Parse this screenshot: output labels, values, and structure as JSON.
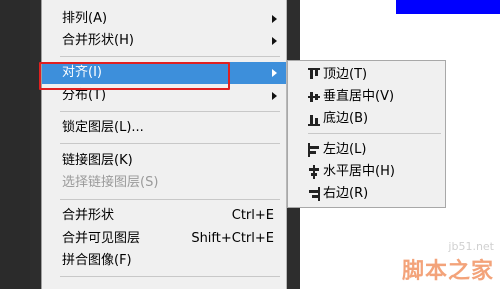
{
  "menu": {
    "items": [
      {
        "label": "排列(A)",
        "has_submenu": true
      },
      {
        "label": "合并形状(H)",
        "has_submenu": true
      },
      {
        "label": "对齐(I)",
        "has_submenu": true,
        "highlighted": true
      },
      {
        "label": "分布(T)",
        "has_submenu": true
      },
      {
        "label": "锁定图层(L)..."
      },
      {
        "label": "链接图层(K)"
      },
      {
        "label": "选择链接图层(S)",
        "disabled": true
      },
      {
        "label": "合并形状",
        "shortcut": "Ctrl+E"
      },
      {
        "label": "合并可见图层",
        "shortcut": "Shift+Ctrl+E"
      },
      {
        "label": "拼合图像(F)"
      }
    ]
  },
  "align_submenu": {
    "items": [
      {
        "label": "顶边(T)",
        "icon": "align-top-icon"
      },
      {
        "label": "垂直居中(V)",
        "icon": "align-vertical-center-icon"
      },
      {
        "label": "底边(B)",
        "icon": "align-bottom-icon"
      },
      {
        "label": "左边(L)",
        "icon": "align-left-icon"
      },
      {
        "label": "水平居中(H)",
        "icon": "align-horizontal-center-icon"
      },
      {
        "label": "右边(R)",
        "icon": "align-right-icon"
      }
    ]
  },
  "watermark": {
    "domain": "jb51.net",
    "text": "脚本之家"
  },
  "colors": {
    "highlight": "#3d8fdb",
    "annotation": "#e02020",
    "canvas_blue": "#0000ff"
  }
}
